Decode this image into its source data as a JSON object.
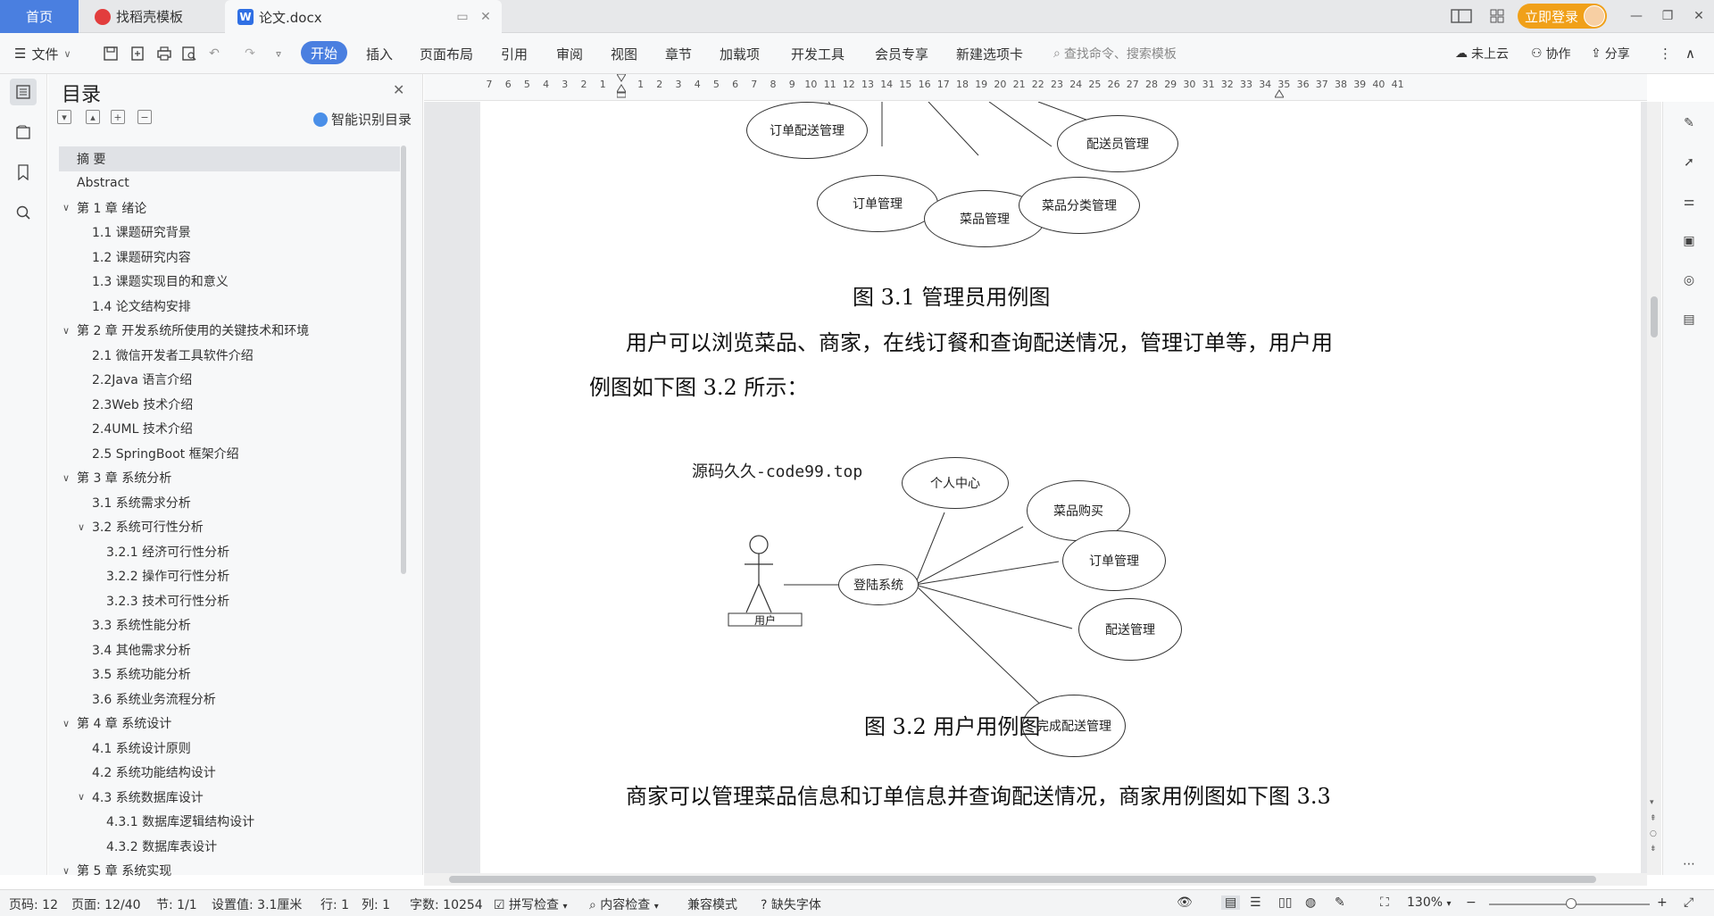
{
  "tabs": {
    "home": "首页",
    "daoke": "找稻壳模板",
    "doc": "论文.docx"
  },
  "login": "立即登录",
  "ribbon": {
    "file": "文件",
    "items": [
      "开始",
      "插入",
      "页面布局",
      "引用",
      "审阅",
      "视图",
      "章节",
      "加载项",
      "开发工具",
      "会员专享",
      "新建选项卡"
    ],
    "search": "查找命令、搜索模板",
    "cloud": "未上云",
    "collab": "协作",
    "share": "分享"
  },
  "ruler_ticks": [
    "7",
    "6",
    "5",
    "4",
    "3",
    "2",
    "1",
    "",
    "1",
    "2",
    "3",
    "4",
    "5",
    "6",
    "7",
    "8",
    "9",
    "10",
    "11",
    "12",
    "13",
    "14",
    "15",
    "16",
    "17",
    "18",
    "19",
    "20",
    "21",
    "22",
    "23",
    "24",
    "25",
    "26",
    "27",
    "28",
    "29",
    "30",
    "31",
    "32",
    "33",
    "34",
    "35",
    "36",
    "37",
    "38",
    "39",
    "40",
    "41"
  ],
  "toc": {
    "title": "目录",
    "smart": "智能识别目录",
    "items": [
      {
        "text": "摘  要",
        "level": 0,
        "sel": true
      },
      {
        "text": "Abstract",
        "level": 0
      },
      {
        "text": "第 1 章  绪论",
        "level": 0,
        "chev": true
      },
      {
        "text": "1.1 课题研究背景",
        "level": 1
      },
      {
        "text": "1.2 课题研究内容",
        "level": 1
      },
      {
        "text": "1.3 课题实现目的和意义",
        "level": 1
      },
      {
        "text": "1.4 论文结构安排",
        "level": 1
      },
      {
        "text": "第 2 章  开发系统所使用的关键技术和环境",
        "level": 0,
        "chev": true
      },
      {
        "text": "2.1 微信开发者工具软件介绍",
        "level": 1
      },
      {
        "text": "2.2Java 语言介绍",
        "level": 1
      },
      {
        "text": "2.3Web 技术介绍",
        "level": 1
      },
      {
        "text": "2.4UML 技术介绍",
        "level": 1
      },
      {
        "text": "2.5 SpringBoot 框架介绍",
        "level": 1
      },
      {
        "text": "第 3 章  系统分析",
        "level": 0,
        "chev": true
      },
      {
        "text": "3.1 系统需求分析",
        "level": 1
      },
      {
        "text": "3.2 系统可行性分析",
        "level": 1,
        "chev": true
      },
      {
        "text": "3.2.1 经济可行性分析",
        "level": 2
      },
      {
        "text": "3.2.2 操作可行性分析",
        "level": 2
      },
      {
        "text": "3.2.3 技术可行性分析",
        "level": 2
      },
      {
        "text": "3.3 系统性能分析",
        "level": 1
      },
      {
        "text": "3.4 其他需求分析",
        "level": 1
      },
      {
        "text": "3.5 系统功能分析",
        "level": 1
      },
      {
        "text": "3.6 系统业务流程分析",
        "level": 1
      },
      {
        "text": "第 4 章  系统设计",
        "level": 0,
        "chev": true
      },
      {
        "text": "4.1 系统设计原则",
        "level": 1
      },
      {
        "text": "4.2 系统功能结构设计",
        "level": 1
      },
      {
        "text": "4.3 系统数据库设计",
        "level": 1,
        "chev": true
      },
      {
        "text": "4.3.1 数据库逻辑结构设计",
        "level": 2
      },
      {
        "text": "4.3.2 数据库表设计",
        "level": 2
      },
      {
        "text": "第 5 章  系统实现",
        "level": 0,
        "chev": true
      }
    ]
  },
  "document": {
    "fig1_nodes": [
      "订单配送管理",
      "配送员管理",
      "订单管理",
      "菜品管理",
      "菜品分类管理"
    ],
    "fig1_caption": "图 3.1 管理员用例图",
    "para1_line1": "用户可以浏览菜品、商家，在线订餐和查询配送情况，管理订单等，用户用",
    "para1_line2": "例图如下图 3.2 所示：",
    "watermark": "源码久久-code99.top",
    "actor": "用户",
    "login_node": "登陆系统",
    "fig2_nodes": [
      "个人中心",
      "菜品购买",
      "订单管理",
      "配送管理",
      "完成配送管理"
    ],
    "fig2_caption": "图 3.2 用户用例图",
    "para2_line1": "商家可以管理菜品信息和订单信息并查询配送情况，商家用例图如下图 3.3"
  },
  "status": {
    "page_code": "页码: 12",
    "page": "页面: 12/40",
    "section": "节: 1/1",
    "setting": "设置值: 3.1厘米",
    "row": "行: 1",
    "col": "列: 1",
    "words": "字数: 10254",
    "spell": "拼写检查",
    "content_check": "内容检查",
    "compat": "兼容模式",
    "missing_font": "缺失字体",
    "zoom": "130%"
  }
}
